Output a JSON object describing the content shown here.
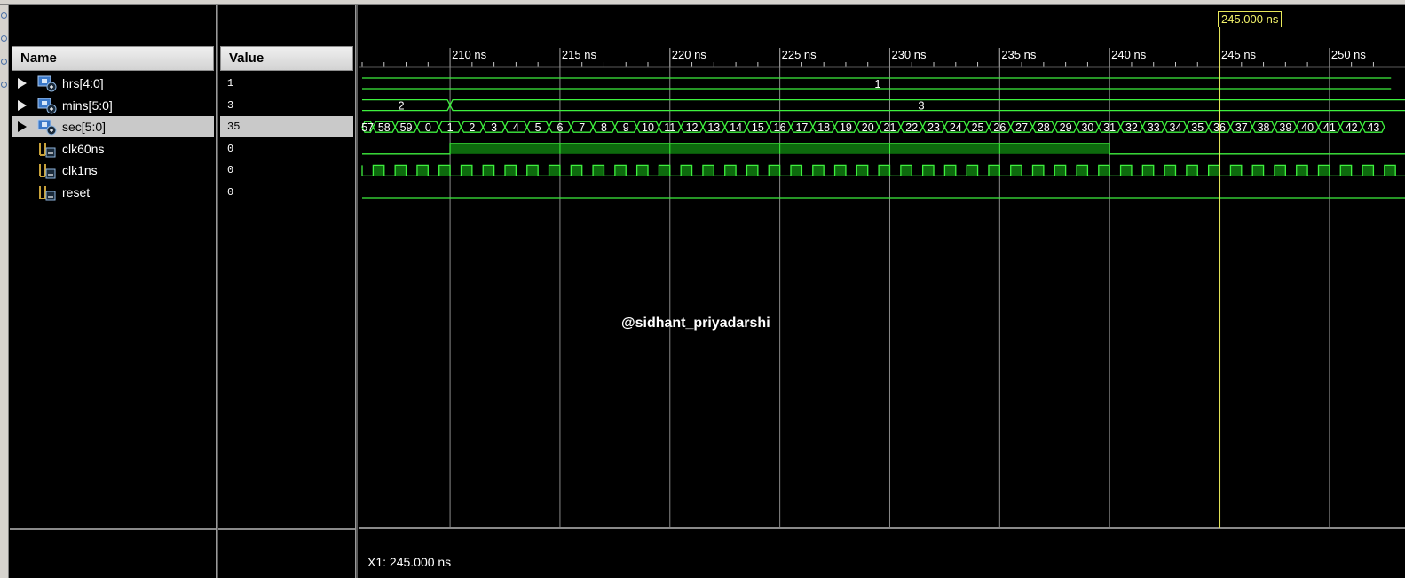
{
  "columns": {
    "name": "Name",
    "value": "Value"
  },
  "signals": [
    {
      "name": "hrs[4:0]",
      "value": "1",
      "expandable": true,
      "type": "bus",
      "selected": false
    },
    {
      "name": "mins[5:0]",
      "value": "3",
      "expandable": true,
      "type": "bus",
      "selected": false
    },
    {
      "name": "sec[5:0]",
      "value": "35",
      "expandable": true,
      "type": "bus",
      "selected": true
    },
    {
      "name": "clk60ns",
      "value": "0",
      "expandable": false,
      "type": "logic",
      "selected": false
    },
    {
      "name": "clk1ns",
      "value": "0",
      "expandable": false,
      "type": "logic",
      "selected": false
    },
    {
      "name": "reset",
      "value": "0",
      "expandable": false,
      "type": "logic",
      "selected": false
    }
  ],
  "timeline": {
    "unit": "ns",
    "major_ticks": [
      "210 ns",
      "215 ns",
      "220 ns",
      "225 ns",
      "230 ns",
      "235 ns",
      "240 ns",
      "245 ns",
      "250 ns"
    ],
    "major_tick_values": [
      210,
      215,
      220,
      225,
      230,
      235,
      240,
      245,
      250
    ],
    "view_start": 206,
    "view_end": 252.8
  },
  "waveforms": {
    "hrs": {
      "segments": [
        {
          "label": "1",
          "start": 206,
          "end": 252.8
        }
      ]
    },
    "mins": {
      "segments": [
        {
          "label": "2",
          "start": 206,
          "end": 210
        },
        {
          "label": "3",
          "start": 210,
          "end": 252.8
        }
      ]
    },
    "sec": {
      "first_label": "57",
      "first_start": 206,
      "first_transition": 206.5,
      "period": 1,
      "labels": [
        "57",
        "58",
        "59",
        "0",
        "1",
        "2",
        "3",
        "4",
        "5",
        "6",
        "7",
        "8",
        "9",
        "10",
        "11",
        "12",
        "13",
        "14",
        "15",
        "16",
        "17",
        "18",
        "19",
        "20",
        "21",
        "22",
        "23",
        "24",
        "25",
        "26",
        "27",
        "28",
        "29",
        "30",
        "31",
        "32",
        "33",
        "34",
        "35",
        "36",
        "37",
        "38",
        "39",
        "40",
        "41",
        "42",
        "43"
      ]
    },
    "clk60ns": {
      "high_from": 210,
      "high_to": 240,
      "dashes_every": 5
    },
    "clk1ns": {
      "period": 1,
      "duty": 0.5,
      "first_rise": 206.5
    },
    "reset": {
      "level": 0
    }
  },
  "cursor": {
    "flag_label": "245.000 ns",
    "position": 245,
    "readout": "X1: 245.000 ns",
    "color": "#f2f26a"
  },
  "watermark": "@sidhant_priyadarshi",
  "colors": {
    "wave": "#3ef03e",
    "bus_fill": "#0d6a0d",
    "grid": "#8a8a8a",
    "cursor": "#e8e85a"
  }
}
